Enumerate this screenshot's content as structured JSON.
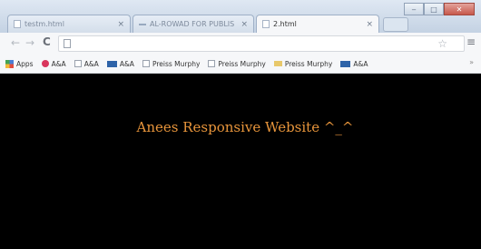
{
  "tabs": [
    {
      "label": "testm.html",
      "active": false,
      "favicon": "page-icon"
    },
    {
      "label": "AL-ROWAD FOR PUBLIS",
      "active": false,
      "favicon": "site-icon"
    },
    {
      "label": "2.html",
      "active": true,
      "favicon": "page-icon"
    }
  ],
  "window_controls": {
    "minimize": "‒",
    "maximize": "□",
    "close": "✕"
  },
  "toolbar": {
    "url": "",
    "back": "←",
    "forward": "→",
    "reload": "C",
    "star": "☆",
    "menu": "≡"
  },
  "bookmarks": [
    {
      "label": "Apps",
      "icon": "apps-icon"
    },
    {
      "label": "A&A",
      "icon": "circle-icon"
    },
    {
      "label": "A&A",
      "icon": "page-icon"
    },
    {
      "label": "A&A",
      "icon": "blue-icon"
    },
    {
      "label": "Preiss Murphy",
      "icon": "page-icon"
    },
    {
      "label": "Preiss Murphy",
      "icon": "page-icon"
    },
    {
      "label": "Preiss Murphy",
      "icon": "folder-icon"
    },
    {
      "label": "A&A",
      "icon": "blue-icon"
    }
  ],
  "bookmarks_more": "»",
  "page": {
    "headline": "Anees Responsive Website ^_^"
  },
  "colors": {
    "page_background": "#000000",
    "headline": "#e8953b",
    "close_button": "#c7584b"
  }
}
